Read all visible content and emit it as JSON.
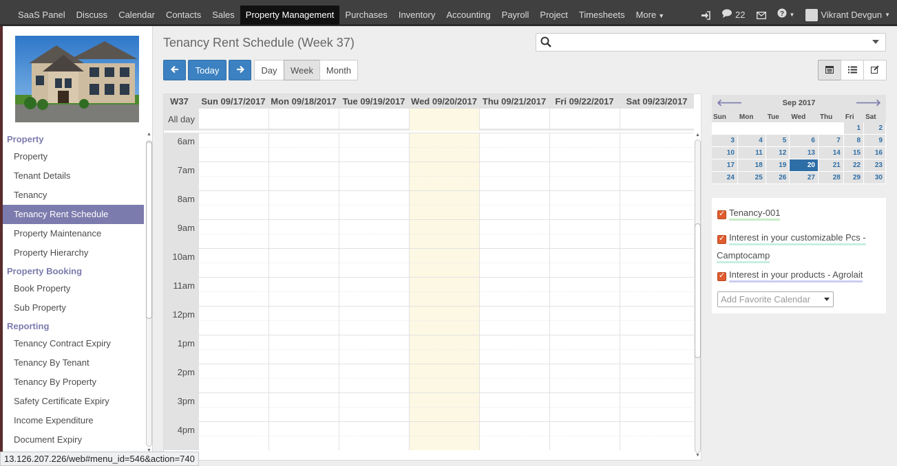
{
  "topbar": {
    "menu": [
      {
        "label": "SaaS Panel",
        "active": false
      },
      {
        "label": "Discuss",
        "active": false
      },
      {
        "label": "Calendar",
        "active": false
      },
      {
        "label": "Contacts",
        "active": false
      },
      {
        "label": "Sales",
        "active": false
      },
      {
        "label": "Property Management",
        "active": true
      },
      {
        "label": "Purchases",
        "active": false
      },
      {
        "label": "Inventory",
        "active": false
      },
      {
        "label": "Accounting",
        "active": false
      },
      {
        "label": "Payroll",
        "active": false
      },
      {
        "label": "Project",
        "active": false
      },
      {
        "label": "Timesheets",
        "active": false
      },
      {
        "label": "More",
        "active": false
      }
    ],
    "chat_count": "22",
    "user_name": "Vikrant Devgun"
  },
  "sidebar": {
    "sections": [
      {
        "header": "Property",
        "items": [
          "Property",
          "Tenant Details",
          "Tenancy",
          "Tenancy Rent Schedule",
          "Property Maintenance",
          "Property Hierarchy"
        ]
      },
      {
        "header": "Property Booking",
        "items": [
          "Book Property",
          "Sub Property"
        ]
      },
      {
        "header": "Reporting",
        "items": [
          "Tenancy Contract Expiry",
          "Tenancy By Tenant",
          "Tenancy By Property",
          "Safety Certificate Expiry",
          "Income Expenditure",
          "Document Expiry"
        ]
      }
    ],
    "active_item": "Tenancy Rent Schedule"
  },
  "status_url": "13.126.207.226/web#menu_id=546&action=740",
  "header": {
    "title": "Tenancy Rent Schedule (Week 37)",
    "search_placeholder": "",
    "today_label": "Today",
    "scale_buttons": [
      "Day",
      "Week",
      "Month"
    ],
    "active_scale": "Week"
  },
  "calendar": {
    "week_label": "W37",
    "days": [
      "Sun 09/17/2017",
      "Mon 09/18/2017",
      "Tue 09/19/2017",
      "Wed 09/20/2017",
      "Thu 09/21/2017",
      "Fri 09/22/2017",
      "Sat 09/23/2017"
    ],
    "today_index": 3,
    "all_day_label": "All day",
    "hours": [
      "6am",
      "7am",
      "8am",
      "9am",
      "10am",
      "11am",
      "12pm",
      "1pm",
      "2pm",
      "3pm",
      "4pm"
    ]
  },
  "mini_calendar": {
    "title": "Sep 2017",
    "weekdays": [
      "Sun",
      "Mon",
      "Tue",
      "Wed",
      "Thu",
      "Fri",
      "Sat"
    ],
    "weeks": [
      [
        "",
        "",
        "",
        "",
        "",
        "1",
        "2"
      ],
      [
        "3",
        "4",
        "5",
        "6",
        "7",
        "8",
        "9"
      ],
      [
        "10",
        "11",
        "12",
        "13",
        "14",
        "15",
        "16"
      ],
      [
        "17",
        "18",
        "19",
        "20",
        "21",
        "22",
        "23"
      ],
      [
        "24",
        "25",
        "26",
        "27",
        "28",
        "29",
        "30"
      ]
    ],
    "selected_day": "20"
  },
  "filters": {
    "items": [
      {
        "label_line1": "Tenancy-001",
        "label_line2": "",
        "underline": "#c6ecc6"
      },
      {
        "label_line1": "Interest in your customizable Pcs -",
        "label_line2": "Camptocamp",
        "underline": "#c6eee2"
      },
      {
        "label_line1": "Interest in your products - Agrolait",
        "label_line2": "",
        "underline": "#c9cdf2"
      }
    ],
    "favorite_placeholder": "Add Favorite Calendar"
  },
  "colors": {
    "primary": "#3c81c1",
    "sidebar_active": "#7c7bad",
    "today_column": "#fcf8e3",
    "checkbox": "#e05c2e"
  }
}
